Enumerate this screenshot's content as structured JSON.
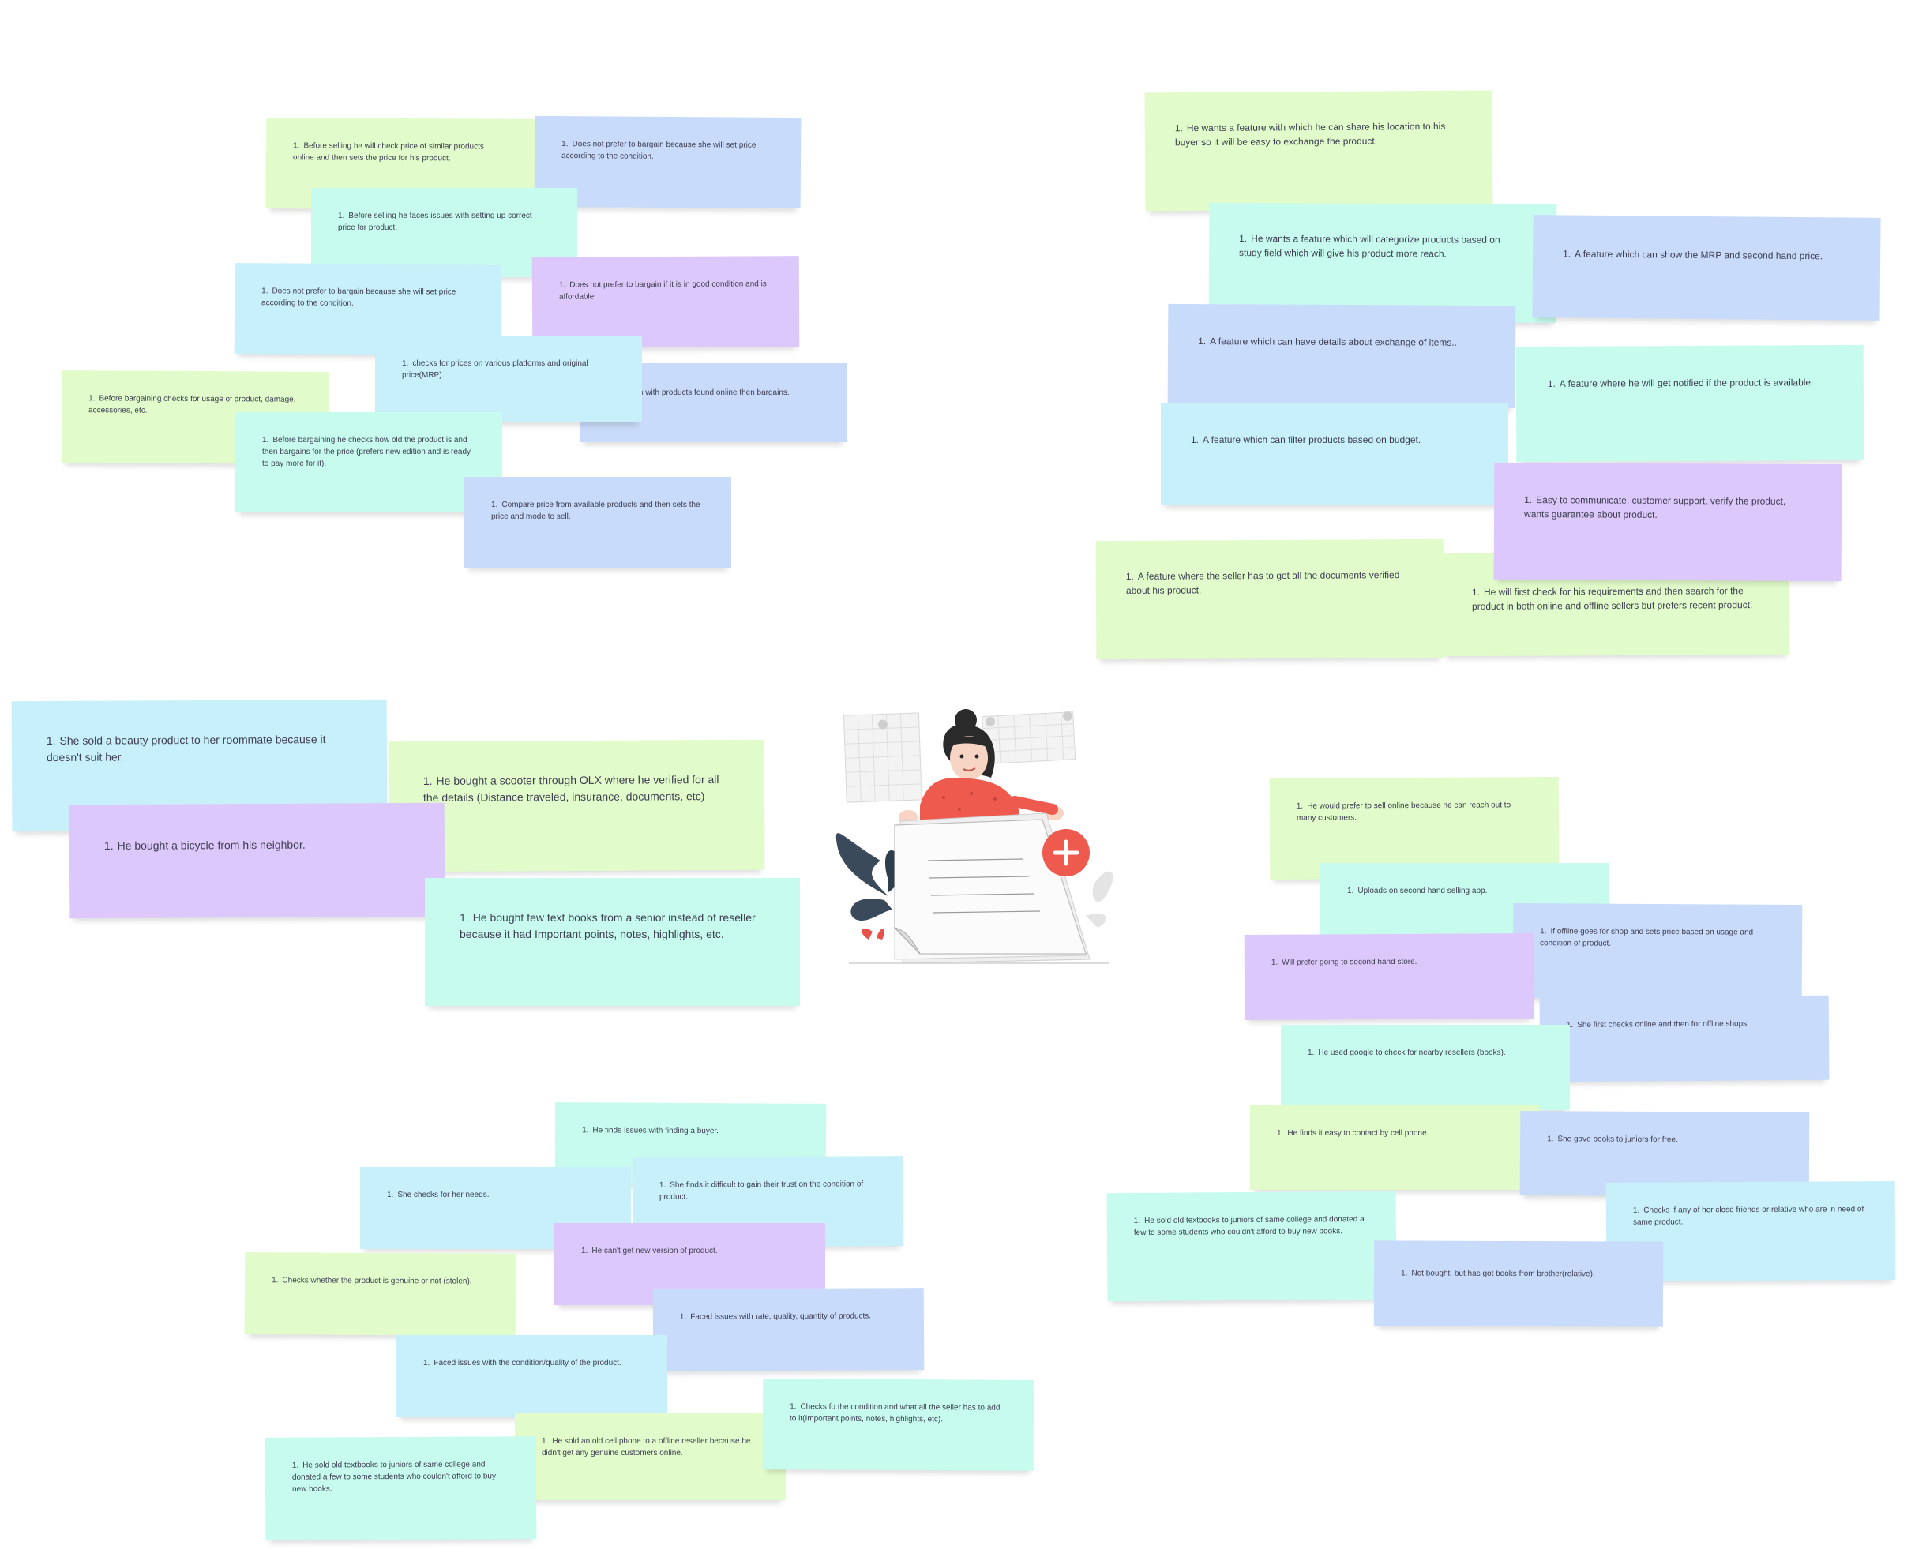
{
  "colors": {
    "canvas": "#ffffff",
    "green": "#e1fbca",
    "blue": "#c9dbfa",
    "cyan": "#c8f0fa",
    "mint": "#c6fbee",
    "purple": "#dcc8fa",
    "accent_red": "#ef5a4f"
  },
  "icons": {
    "illustration": "woman-holding-document-with-plus-icon"
  },
  "clusters": {
    "top_left": [
      {
        "num": "1.",
        "text": "Before selling he will check price of similar products online and then sets the price for his product."
      },
      {
        "num": "1.",
        "text": "Does not prefer to bargain because she will set price according to the condition."
      },
      {
        "num": "1.",
        "text": "Before selling he faces issues with setting up correct price for product."
      },
      {
        "num": "1.",
        "text": "Does not prefer to bargain because she will set price according to the condition."
      },
      {
        "num": "1.",
        "text": "Does not prefer to bargain if it is in good condition and is affordable."
      },
      {
        "num": "1.",
        "text": "es with products found online then bargains."
      },
      {
        "num": "1.",
        "text": "checks for prices on various platforms  and original price(MRP)."
      },
      {
        "num": "1.",
        "text": "Before bargaining checks for usage of product, damage, accessories, etc."
      },
      {
        "num": "1.",
        "text": "Before bargaining he checks how old the product is and then bargains for the price (prefers new edition and is ready to pay more for it)."
      },
      {
        "num": "1.",
        "text": "Compare price from available products and then sets the price and mode to sell."
      }
    ],
    "top_right": [
      {
        "num": "1.",
        "text": "He wants a feature with which he can share his location to his buyer so it will be easy to exchange the product."
      },
      {
        "num": "1.",
        "text": "He wants a feature which will categorize products based on study field which will give his product more reach."
      },
      {
        "num": "1.",
        "text": "A feature which can show the MRP and second hand price."
      },
      {
        "num": "1.",
        "text": "A feature which can have details about exchange of items.."
      },
      {
        "num": "1.",
        "text": "A feature where he will get notified if the product is available."
      },
      {
        "num": "1.",
        "text": "A feature which can filter products based on budget."
      },
      {
        "num": "1.",
        "text": "A feature where the seller has to get all the documents verified about his product."
      },
      {
        "num": "1.",
        "text": "He will first check for his requirements and then search for the product in both online and offline sellers but prefers recent product."
      },
      {
        "num": "1.",
        "text": "Easy to communicate, customer support, verify the product, wants guarantee about product."
      }
    ],
    "middle_left": [
      {
        "num": "1.",
        "text": "She sold a beauty product to her roommate because it doesn't suit her."
      },
      {
        "num": "1.",
        "text": "He bought a scooter through OLX where he verified for all the details (Distance traveled, insurance, documents, etc)"
      },
      {
        "num": "1.",
        "text": "He bought a bicycle from his neighbor."
      },
      {
        "num": "1.",
        "text": "He bought few text books from a senior instead of reseller because it had Important points, notes, highlights, etc."
      }
    ],
    "middle_right": [
      {
        "num": "1.",
        "text": "He would prefer to sell online because he can reach out to many customers."
      },
      {
        "num": "1.",
        "text": "Uploads on second hand selling app."
      },
      {
        "num": "1.",
        "text": "If offline goes for shop and sets price based on usage and condition of product."
      },
      {
        "num": "1.",
        "text": "Will prefer going to second hand store."
      },
      {
        "num": "1.",
        "text": "She first checks online and then for offline shops."
      },
      {
        "num": "1.",
        "text": "He used google to check for nearby resellers (books)."
      },
      {
        "num": "1.",
        "text": "He finds it easy to contact by cell phone."
      },
      {
        "num": "1.",
        "text": "She gave books to juniors for free."
      },
      {
        "num": "1.",
        "text": "Checks if any of her close friends or relative who are in need of same product."
      },
      {
        "num": "1.",
        "text": "He sold old textbooks to juniors of same college and donated a few to some students who couldn't afford to buy new books."
      },
      {
        "num": "1.",
        "text": "Not bought, but has got books from brother(relative)."
      }
    ],
    "bottom_center": [
      {
        "num": "1.",
        "text": "He finds Issues with finding a buyer."
      },
      {
        "num": "1.",
        "text": "She checks for her needs."
      },
      {
        "num": "1.",
        "text": "She finds it difficult to gain their trust on the condition of product."
      },
      {
        "num": "1.",
        "text": "He can't get new version of product."
      },
      {
        "num": "1.",
        "text": "Checks whether the product is genuine or not (stolen)."
      },
      {
        "num": "1.",
        "text": "Faced issues with rate, quality, quantity of products."
      },
      {
        "num": "1.",
        "text": "Faced issues with the condition/quality of the product."
      },
      {
        "num": "1.",
        "text": "Checks fo the condition and what all the seller has to add to it(Important points, notes, highlights, etc)."
      },
      {
        "num": "1.",
        "text": "He sold an old cell phone to a offline reseller because he didn't get any genuine customers online."
      },
      {
        "num": "1.",
        "text": "He sold old textbooks to juniors of same college and donated a few to some students who couldn't afford to buy new books."
      }
    ]
  }
}
